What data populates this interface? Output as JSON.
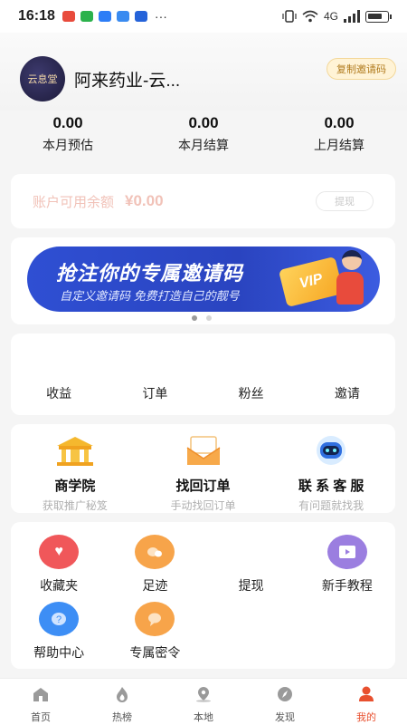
{
  "status_bar": {
    "time": "16:18",
    "dots": "···",
    "network": "4G"
  },
  "header": {
    "avatar_text": "云息堂",
    "username": "阿来药业-云...",
    "invite_tag": "复制邀请码"
  },
  "stats": [
    {
      "value": "0.00",
      "label": "本月预估"
    },
    {
      "value": "0.00",
      "label": "本月结算"
    },
    {
      "value": "0.00",
      "label": "上月结算"
    }
  ],
  "balance": {
    "label": "账户可用余额",
    "amount": "¥0.00",
    "withdraw_label": "提现"
  },
  "banner": {
    "title": "抢注你的专属邀请码",
    "subtitle": "自定义邀请码 免费打造自己的靓号",
    "vip_text": "VIP",
    "page_count": 2,
    "active_page": 1
  },
  "quick_tabs": [
    "收益",
    "订单",
    "粉丝",
    "邀请"
  ],
  "tools": [
    {
      "title": "商学院",
      "subtitle": "获取推广秘笈",
      "icon": "academy-icon"
    },
    {
      "title": "找回订单",
      "subtitle": "手动找回订单",
      "icon": "envelope-icon"
    },
    {
      "title": "联 系 客 服",
      "subtitle": "有问题就找我",
      "icon": "robot-icon"
    }
  ],
  "services": [
    {
      "label": "收藏夹",
      "icon": "heart-icon",
      "color": "#f0575a"
    },
    {
      "label": "足迹",
      "icon": "footprint-icon",
      "color": "#f7a44a"
    },
    {
      "label": "提现",
      "icon": "",
      "color": ""
    },
    {
      "label": "新手教程",
      "icon": "video-icon",
      "color": "#9b7ee0"
    },
    {
      "label": "帮助中心",
      "icon": "question-icon",
      "color": "#3d8ef5"
    },
    {
      "label": "专属密令",
      "icon": "chat-icon",
      "color": "#f7a44a"
    }
  ],
  "bottom_nav": [
    {
      "label": "首页",
      "icon": "home-icon",
      "active": false
    },
    {
      "label": "热榜",
      "icon": "flame-icon",
      "active": false
    },
    {
      "label": "本地",
      "icon": "location-icon",
      "active": false
    },
    {
      "label": "发现",
      "icon": "compass-icon",
      "active": false
    },
    {
      "label": "我的",
      "icon": "user-icon",
      "active": true
    }
  ],
  "colors": {
    "accent": "#e8502f",
    "background": "#f5f5f5",
    "banner_blue": "#2f4fd3",
    "balance_text": "#f1c2b8"
  }
}
